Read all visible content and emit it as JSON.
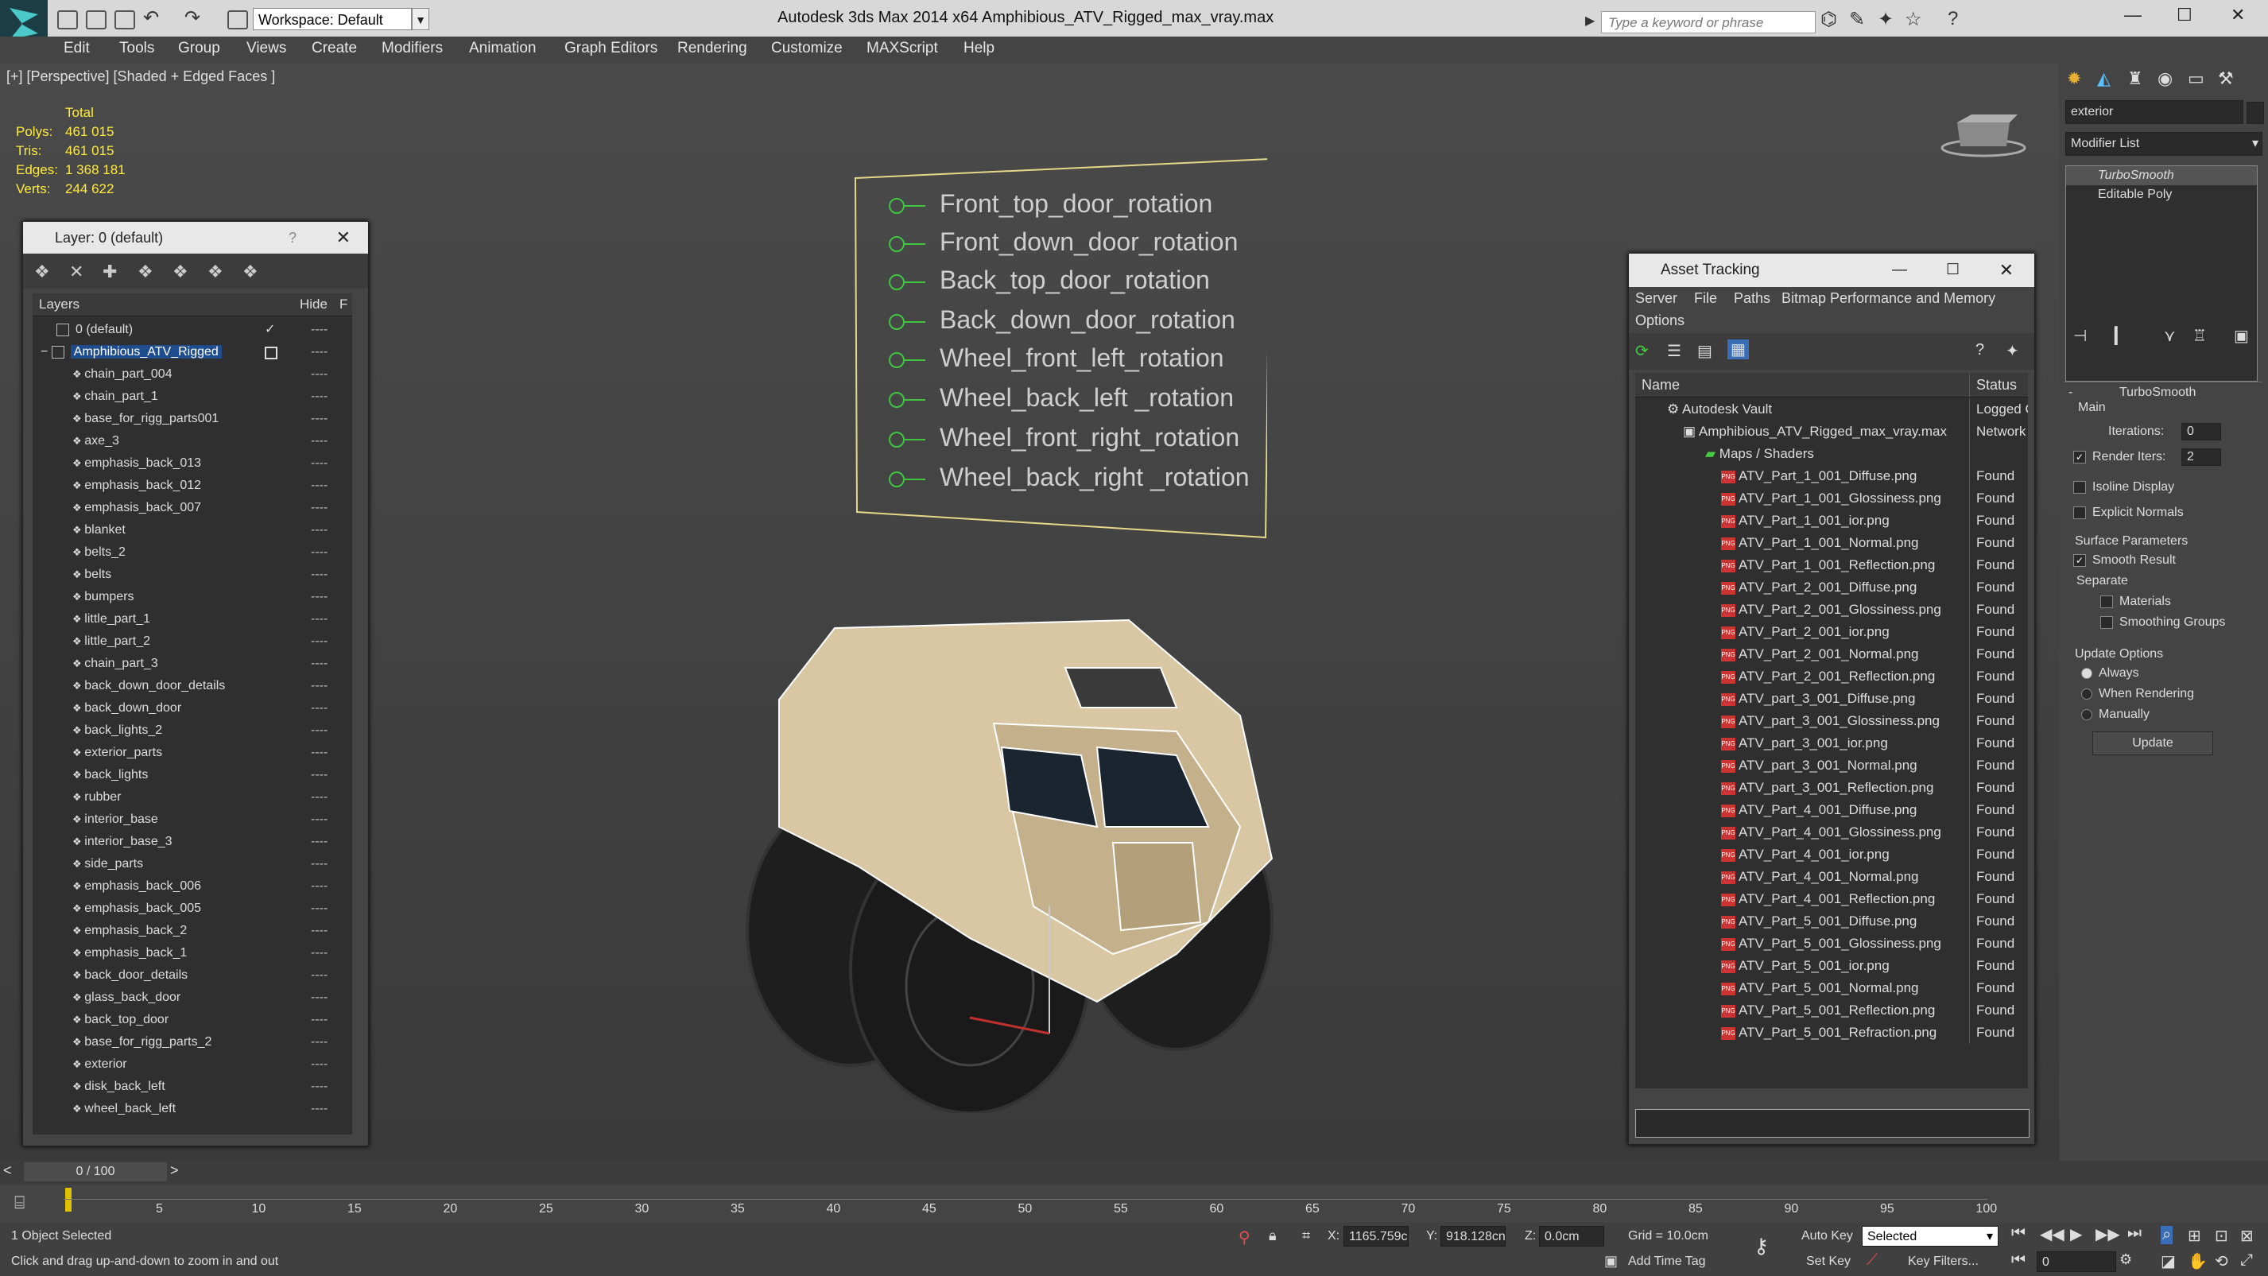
{
  "app": {
    "title": "Autodesk 3ds Max  2014 x64",
    "file": "Amphibious_ATV_Rigged_max_vray.max",
    "workspace": "Workspace: Default",
    "search_placeholder": "Type a keyword or phrase"
  },
  "menu": [
    "Edit",
    "Tools",
    "Group",
    "Views",
    "Create",
    "Modifiers",
    "Animation",
    "Graph Editors",
    "Rendering",
    "Customize",
    "MAXScript",
    "Help"
  ],
  "viewport": {
    "label": "[+] [Perspective] [Shaded + Edged Faces ]",
    "stats": {
      "total_label": "Total",
      "polys_label": "Polys:",
      "polys": "461 015",
      "tris_label": "Tris:",
      "tris": "461 015",
      "edges_label": "Edges:",
      "edges": "1 368 181",
      "verts_label": "Verts:",
      "verts": "244 622"
    },
    "controls": [
      "Front_top_door_rotation",
      "Front_down_door_rotation",
      "Back_top_door_rotation",
      "Back_down_door_rotation",
      "Wheel_front_left_rotation",
      "Wheel_back_left _rotation",
      "Wheel_front_right_rotation",
      "Wheel_back_right _rotation"
    ]
  },
  "layer_window": {
    "title": "Layer: 0 (default)",
    "help": "?",
    "col_layers": "Layers",
    "col_hide": "Hide",
    "col_f": "F",
    "default_layer": "0 (default)",
    "selected_layer": "Amphibious_ATV_Rigged",
    "items": [
      "chain_part_004",
      "chain_part_1",
      "base_for_rigg_parts001",
      "axe_3",
      "emphasis_back_013",
      "emphasis_back_012",
      "emphasis_back_007",
      "blanket",
      "belts_2",
      "belts",
      "bumpers",
      "little_part_1",
      "little_part_2",
      "chain_part_3",
      "back_down_door_details",
      "back_down_door",
      "back_lights_2",
      "exterior_parts",
      "back_lights",
      "rubber",
      "interior_base",
      "interior_base_3",
      "side_parts",
      "emphasis_back_006",
      "emphasis_back_005",
      "emphasis_back_2",
      "emphasis_back_1",
      "back_door_details",
      "glass_back_door",
      "back_top_door",
      "base_for_rigg_parts_2",
      "exterior",
      "disk_back_left",
      "wheel_back_left"
    ],
    "hide_glyph": "----"
  },
  "asset_window": {
    "title": "Asset Tracking",
    "menu": [
      "Server",
      "File",
      "Paths",
      "Bitmap Performance and Memory"
    ],
    "menu2": "Options",
    "col_name": "Name",
    "col_status": "Status",
    "vault": "Autodesk Vault",
    "vault_status": "Logged O",
    "file": "Amphibious_ATV_Rigged_max_vray.max",
    "file_status": "Network",
    "maps": "Maps / Shaders",
    "png_tag": "PNG",
    "assets": [
      {
        "name": "ATV_Part_1_001_Diffuse.png",
        "status": "Found"
      },
      {
        "name": "ATV_Part_1_001_Glossiness.png",
        "status": "Found"
      },
      {
        "name": "ATV_Part_1_001_ior.png",
        "status": "Found"
      },
      {
        "name": "ATV_Part_1_001_Normal.png",
        "status": "Found"
      },
      {
        "name": "ATV_Part_1_001_Reflection.png",
        "status": "Found"
      },
      {
        "name": "ATV_Part_2_001_Diffuse.png",
        "status": "Found"
      },
      {
        "name": "ATV_Part_2_001_Glossiness.png",
        "status": "Found"
      },
      {
        "name": "ATV_Part_2_001_ior.png",
        "status": "Found"
      },
      {
        "name": "ATV_Part_2_001_Normal.png",
        "status": "Found"
      },
      {
        "name": "ATV_Part_2_001_Reflection.png",
        "status": "Found"
      },
      {
        "name": "ATV_part_3_001_Diffuse.png",
        "status": "Found"
      },
      {
        "name": "ATV_part_3_001_Glossiness.png",
        "status": "Found"
      },
      {
        "name": "ATV_part_3_001_ior.png",
        "status": "Found"
      },
      {
        "name": "ATV_part_3_001_Normal.png",
        "status": "Found"
      },
      {
        "name": "ATV_part_3_001_Reflection.png",
        "status": "Found"
      },
      {
        "name": "ATV_Part_4_001_Diffuse.png",
        "status": "Found"
      },
      {
        "name": "ATV_Part_4_001_Glossiness.png",
        "status": "Found"
      },
      {
        "name": "ATV_Part_4_001_ior.png",
        "status": "Found"
      },
      {
        "name": "ATV_Part_4_001_Normal.png",
        "status": "Found"
      },
      {
        "name": "ATV_Part_4_001_Reflection.png",
        "status": "Found"
      },
      {
        "name": "ATV_Part_5_001_Diffuse.png",
        "status": "Found"
      },
      {
        "name": "ATV_Part_5_001_Glossiness.png",
        "status": "Found"
      },
      {
        "name": "ATV_Part_5_001_ior.png",
        "status": "Found"
      },
      {
        "name": "ATV_Part_5_001_Normal.png",
        "status": "Found"
      },
      {
        "name": "ATV_Part_5_001_Reflection.png",
        "status": "Found"
      },
      {
        "name": "ATV_Part_5_001_Refraction.png",
        "status": "Found"
      }
    ]
  },
  "command_panel": {
    "object_name": "exterior",
    "modifier_list": "Modifier List",
    "stack": [
      "TurboSmooth",
      "Editable Poly"
    ],
    "rollout_title": "TurboSmooth",
    "main_label": "Main",
    "iterations_label": "Iterations:",
    "iterations": "0",
    "render_iters_label": "Render Iters:",
    "render_iters": "2",
    "isoline": "Isoline Display",
    "explicit_normals": "Explicit Normals",
    "surface_params": "Surface Parameters",
    "smooth_result": "Smooth Result",
    "separate": "Separate",
    "materials": "Materials",
    "smoothing_groups": "Smoothing Groups",
    "update_options": "Update Options",
    "always": "Always",
    "when_rendering": "When Rendering",
    "manually": "Manually",
    "update_button": "Update"
  },
  "timeline": {
    "frame": "0 / 100",
    "ticks": [
      "5",
      "10",
      "15",
      "20",
      "25",
      "30",
      "35",
      "40",
      "45",
      "50",
      "55",
      "60",
      "65",
      "70",
      "75",
      "80",
      "85",
      "90",
      "95",
      "100"
    ]
  },
  "status": {
    "selected": "1 Object Selected",
    "prompt": "Click and drag up-and-down to zoom in and out",
    "x_label": "X:",
    "x": "1165.759c",
    "y_label": "Y:",
    "y": "918.128cn",
    "z_label": "Z:",
    "z": "0.0cm",
    "grid": "Grid = 10.0cm",
    "auto_key": "Auto Key",
    "set_key": "Set Key",
    "selected_dropdown": "Selected",
    "key_filters": "Key Filters...",
    "add_time_tag": "Add Time Tag",
    "frame_field": "0"
  },
  "colors": {
    "accent": "#1e4c8c",
    "stats": "#ffeb3b",
    "controls": "#3fc53f",
    "timeline_marker": "#e0c000"
  }
}
